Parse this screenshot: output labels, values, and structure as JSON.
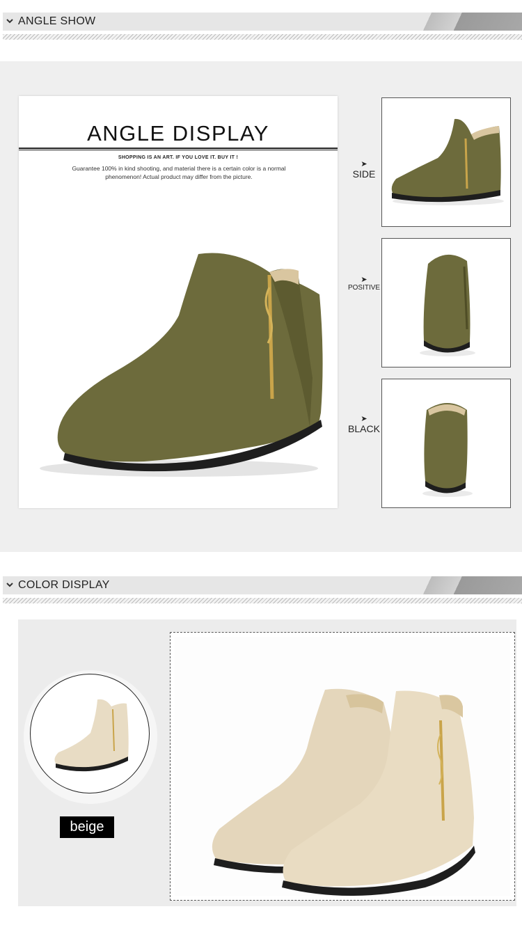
{
  "angle_section": {
    "header": "ANGLE SHOW",
    "card": {
      "title": "ANGLE DISPLAY",
      "slogan": "SHOPPING IS AN ART. IF YOU LOVE IT. BUY IT !",
      "note": "Guarantee 100% in kind shooting, and material there is a certain color is a normal phenomenon! Actual product may differ from the picture."
    },
    "views": [
      {
        "label": "SIDE",
        "arrow": "➤"
      },
      {
        "label": "POSITIVE",
        "arrow": "➤"
      },
      {
        "label": "BLACK",
        "arrow": "➤"
      }
    ]
  },
  "color_section": {
    "header": "COLOR DISPLAY",
    "swatch": "beige"
  },
  "colors": {
    "olive": "#6b6b3a",
    "beige": "#e8dcc4",
    "header_bar": "#e6e6e6",
    "panel_bg": "#efefef"
  },
  "icons": {
    "section_chevron": "chevron-down-icon"
  }
}
